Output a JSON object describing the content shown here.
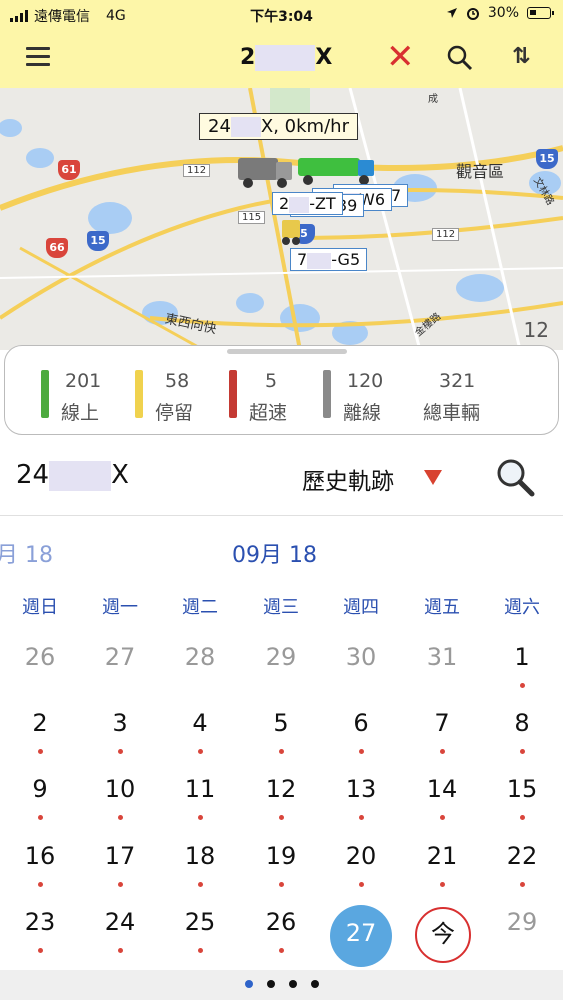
{
  "status_bar": {
    "carrier": "遠傳電信",
    "network": "4G",
    "time": "下午3:04",
    "battery": "30%"
  },
  "toolbar": {
    "vehicle_prefix": "2",
    "vehicle_suffix": "X"
  },
  "map": {
    "tooltip_prefix": "24",
    "tooltip_suffix": "X, 0km/hr",
    "vehicle_labels": {
      "a_prefix": "2",
      "a_suffix": "-ZT",
      "b": "39",
      "c": "W6",
      "d": "V7",
      "e_prefix": "7",
      "e_suffix": "-G5"
    },
    "road_labels": [
      "61",
      "112",
      "115",
      "66",
      "15",
      "5",
      "112",
      "15"
    ],
    "places": [
      "觀音區",
      "東西向快",
      "金樓路",
      "文林路",
      "成"
    ],
    "corner_number": "12"
  },
  "legend": {
    "items": [
      {
        "count": "201",
        "label": "線上",
        "color": "#4caa3e"
      },
      {
        "count": "58",
        "label": "停留",
        "color": "#f0d24e"
      },
      {
        "count": "5",
        "label": "超速",
        "color": "#c43a33"
      },
      {
        "count": "120",
        "label": "離線",
        "color": "#8a8a8a"
      },
      {
        "count": "321",
        "label": "總車輛"
      }
    ]
  },
  "history": {
    "vehicle_prefix": "24",
    "vehicle_suffix": "X",
    "mode": "歷史軌跡"
  },
  "calendar": {
    "prev_month": "月 18",
    "month": "09月 18",
    "weekdays": [
      "週日",
      "週一",
      "週二",
      "週三",
      "週四",
      "週五",
      "週六"
    ],
    "weeks": [
      [
        "26",
        "27",
        "28",
        "29",
        "30",
        "31",
        "1"
      ],
      [
        "2",
        "3",
        "4",
        "5",
        "6",
        "7",
        "8"
      ],
      [
        "9",
        "10",
        "11",
        "12",
        "13",
        "14",
        "15"
      ],
      [
        "16",
        "17",
        "18",
        "19",
        "20",
        "21",
        "22"
      ],
      [
        "23",
        "24",
        "25",
        "26",
        "27",
        "今",
        "29"
      ]
    ],
    "selected": "27",
    "today_label": "今"
  },
  "pager": {
    "total": 4,
    "active": 1
  }
}
